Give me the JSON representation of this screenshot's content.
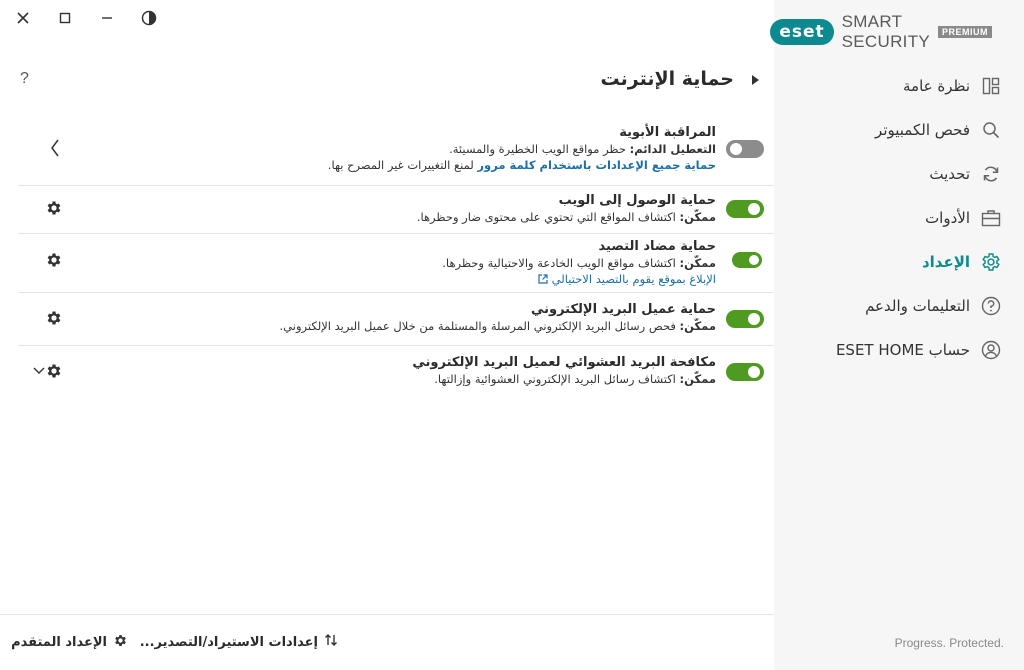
{
  "window": {
    "controls": [
      "close-icon",
      "maximize-icon",
      "minimize-icon",
      "contrast-icon"
    ]
  },
  "brand": {
    "logo_text": "eset",
    "product": "SMART SECURITY",
    "badge": "PREMIUM",
    "tagline": "Progress. Protected.",
    "accent_color": "#0c8a8f"
  },
  "sidebar": {
    "items": [
      {
        "label": "نظرة عامة",
        "icon": "overview-icon"
      },
      {
        "label": "فحص الكمبيوتر",
        "icon": "search-icon"
      },
      {
        "label": "تحديث",
        "icon": "refresh-icon"
      },
      {
        "label": "الأدوات",
        "icon": "toolbox-icon"
      },
      {
        "label": "الإعداد",
        "icon": "gear-icon",
        "active": true
      },
      {
        "label": "التعليمات والدعم",
        "icon": "help-circle-icon"
      },
      {
        "label": "حساب ESET HOME",
        "icon": "account-icon"
      }
    ]
  },
  "page": {
    "title": "حماية الإنترنت",
    "help_glyph": "?"
  },
  "rows": [
    {
      "title": "المراقبة الأبوية",
      "status_label": "التعطيل الدائم:",
      "desc": " حظر مواقع الويب الخطيرة والمسيئة.",
      "link_bold": "حماية جميع الإعدادات باستخدام كلمة مرور",
      "link_rest": " لمنع التغييرات غير المصرح بها.",
      "enabled": false
    },
    {
      "title": "حماية الوصول إلى الويب",
      "status_label": "ممكّن:",
      "desc": " اكتشاف المواقع التي تحتوي على محتوى ضار وحظرها.",
      "enabled": true
    },
    {
      "title": "حماية مضاد التصيد",
      "status_label": "ممكّن:",
      "desc": " اكتشاف مواقع الويب الخادعة والاحتيالية وحظرها.",
      "link": "الإبلاغ بموقع يقوم بالتصيد الاحتيالي",
      "enabled": true
    },
    {
      "title": "حماية عميل البريد الإلكتروني",
      "status_label": "ممكّن:",
      "desc": " فحص رسائل البريد الإلكتروني المرسلة والمستلمة من خلال عميل البريد الإلكتروني.",
      "enabled": true
    },
    {
      "title": "مكافحة البريد العشوائي لعميل البريد الإلكتروني",
      "status_label": "ممكّن:",
      "desc": " اكتشاف رسائل البريد الإلكتروني العشوائية وإزالتها.",
      "enabled": true
    }
  ],
  "footer": {
    "import_export": "إعدادات الاستيراد/التصدير...",
    "advanced": "الإعداد المتقدم"
  },
  "colors": {
    "toggle_on": "#4f9a21",
    "toggle_off": "#8c8c8c",
    "link": "#1d6fa8"
  }
}
